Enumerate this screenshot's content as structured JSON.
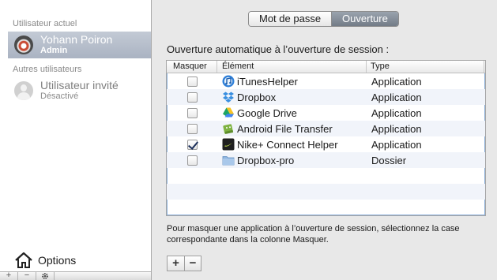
{
  "sidebar": {
    "current_user_header": "Utilisateur actuel",
    "current_user": {
      "name": "Yohann Poiron",
      "role": "Admin",
      "avatar_icon": "avatar-icon"
    },
    "other_users_header": "Autres utilisateurs",
    "other_users": [
      {
        "name": "Utilisateur invité",
        "status": "Désactivé",
        "avatar_icon": "guest-avatar-icon"
      }
    ],
    "options_label": "Options",
    "options_icon": "home-icon",
    "toolbar": {
      "add_label": "+",
      "remove_label": "−",
      "action_icon": "gear-icon"
    }
  },
  "tabs": [
    {
      "label": "Mot de passe",
      "active": false
    },
    {
      "label": "Ouverture",
      "active": true
    }
  ],
  "login_items": {
    "title": "Ouverture automatique à l’ouverture de session :",
    "columns": [
      "Masquer",
      "Élément",
      "Type"
    ],
    "rows": [
      {
        "hide": false,
        "name": "iTunesHelper",
        "type": "Application",
        "icon": "itunes-icon"
      },
      {
        "hide": false,
        "name": "Dropbox",
        "type": "Application",
        "icon": "dropbox-icon"
      },
      {
        "hide": false,
        "name": "Google Drive",
        "type": "Application",
        "icon": "google-drive-icon"
      },
      {
        "hide": false,
        "name": "Android File Transfer",
        "type": "Application",
        "icon": "android-icon"
      },
      {
        "hide": true,
        "name": "Nike+ Connect Helper",
        "type": "Application",
        "icon": "nike-icon"
      },
      {
        "hide": false,
        "name": "Dropbox-pro",
        "type": "Dossier",
        "icon": "folder-icon"
      }
    ],
    "help_text": "Pour masquer une application à l’ouverture de session, sélectionnez la case correspondante dans la colonne Masquer.",
    "add_label": "+",
    "remove_label": "−"
  },
  "colors": {
    "selection": "#aab3c2",
    "tab_active": "#7a838e",
    "table_focus": "#8cb1dc",
    "row_alt": "#f1f4fa"
  }
}
